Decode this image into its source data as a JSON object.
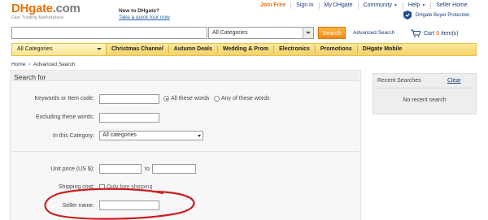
{
  "header": {
    "logo": {
      "dh": "DH",
      "gate": "gate",
      "com": ".com",
      "tagline": "Fast Trading Marketplace"
    },
    "new_to": {
      "title": "New to DHgate?",
      "tour_link": "Take a quick tour now"
    },
    "top_links": [
      {
        "label": "Join Free"
      },
      {
        "label": "Sign in"
      },
      {
        "label": "My DHgate"
      },
      {
        "label": "Community"
      },
      {
        "label": "Help"
      },
      {
        "label": "Seller Home"
      }
    ],
    "buyer_protection": "DHgate Buyer Protection"
  },
  "search": {
    "query": "",
    "category": "All Categories",
    "button": "Search",
    "advanced_link": "Advanced Search",
    "cart": {
      "label_prefix": "Cart",
      "count": "0",
      "label_suffix": "item(s)"
    }
  },
  "nav": {
    "all_categories": "All Categories",
    "items": [
      "Christmas Channel",
      "Autumn Deals",
      "Wedding & Prom",
      "Electronics",
      "Promotions",
      "DHgate Mobile"
    ]
  },
  "breadcrumb": {
    "home": "Home",
    "sep": ">",
    "current": "Advanced Search"
  },
  "form": {
    "title": "Search for",
    "keywords_label": "Keywords or Item code:",
    "keywords_value": "",
    "radio_all": "All these words",
    "radio_any": "Any of these words",
    "excluding_label": "Excluding these words:",
    "excluding_value": "",
    "category_label": "In this Category:",
    "category_value": "All categories",
    "unit_price_label": "Unit price (US $):",
    "price_from": "",
    "price_to_label": "to",
    "price_to": "",
    "shipping_label": "Shipping cost:",
    "free_shipping_label": "Only free shipping",
    "seller_label": "Seller name:",
    "seller_value": ""
  },
  "recent": {
    "title": "Recent Searches",
    "clear": "Clear",
    "empty": "No recent search"
  },
  "colors": {
    "brand_orange": "#e8720c",
    "link_blue": "#1a3e7a",
    "nav_yellow": "#f4d26a",
    "annotation_red": "#cc1f24"
  }
}
